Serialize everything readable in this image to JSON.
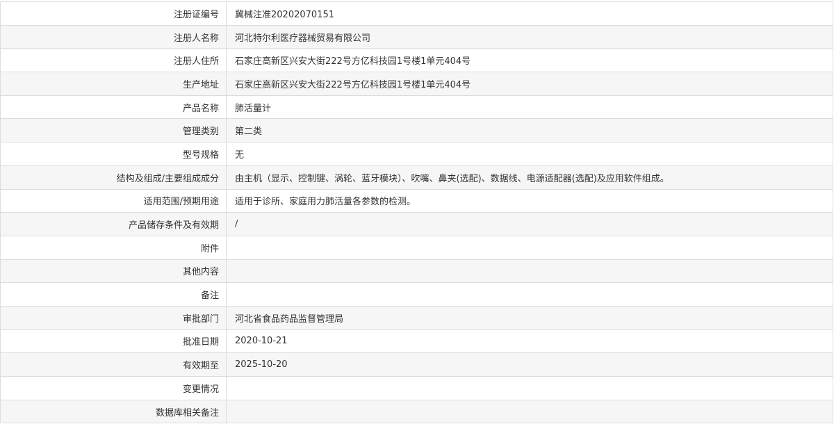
{
  "rows": [
    {
      "label": "注册证编号",
      "value": "冀械注准20202070151"
    },
    {
      "label": "注册人名称",
      "value": "河北特尔利医疗器械贸易有限公司"
    },
    {
      "label": "注册人住所",
      "value": "石家庄高新区兴安大街222号方亿科技园1号楼1单元404号"
    },
    {
      "label": "生产地址",
      "value": "石家庄高新区兴安大街222号方亿科技园1号楼1单元404号"
    },
    {
      "label": "产品名称",
      "value": "肺活量计"
    },
    {
      "label": "管理类别",
      "value": "第二类"
    },
    {
      "label": "型号规格",
      "value": "无"
    },
    {
      "label": "结构及组成/主要组成成分",
      "value": "由主机（显示、控制键、涡轮、蓝牙模块）、吹嘴、鼻夹(选配)、数据线、电源适配器(选配)及应用软件组成。"
    },
    {
      "label": "适用范围/预期用途",
      "value": "适用于诊所、家庭用力肺活量各参数的检测。"
    },
    {
      "label": "产品储存条件及有效期",
      "value": "/"
    },
    {
      "label": "附件",
      "value": ""
    },
    {
      "label": "其他内容",
      "value": ""
    },
    {
      "label": "备注",
      "value": ""
    },
    {
      "label": "审批部门",
      "value": "河北省食品药品监督管理局"
    },
    {
      "label": "批准日期",
      "value": "2020-10-21"
    },
    {
      "label": "有效期至",
      "value": "2025-10-20"
    },
    {
      "label": "变更情况",
      "value": ""
    },
    {
      "label": "数据库相关备注",
      "value": ""
    }
  ]
}
